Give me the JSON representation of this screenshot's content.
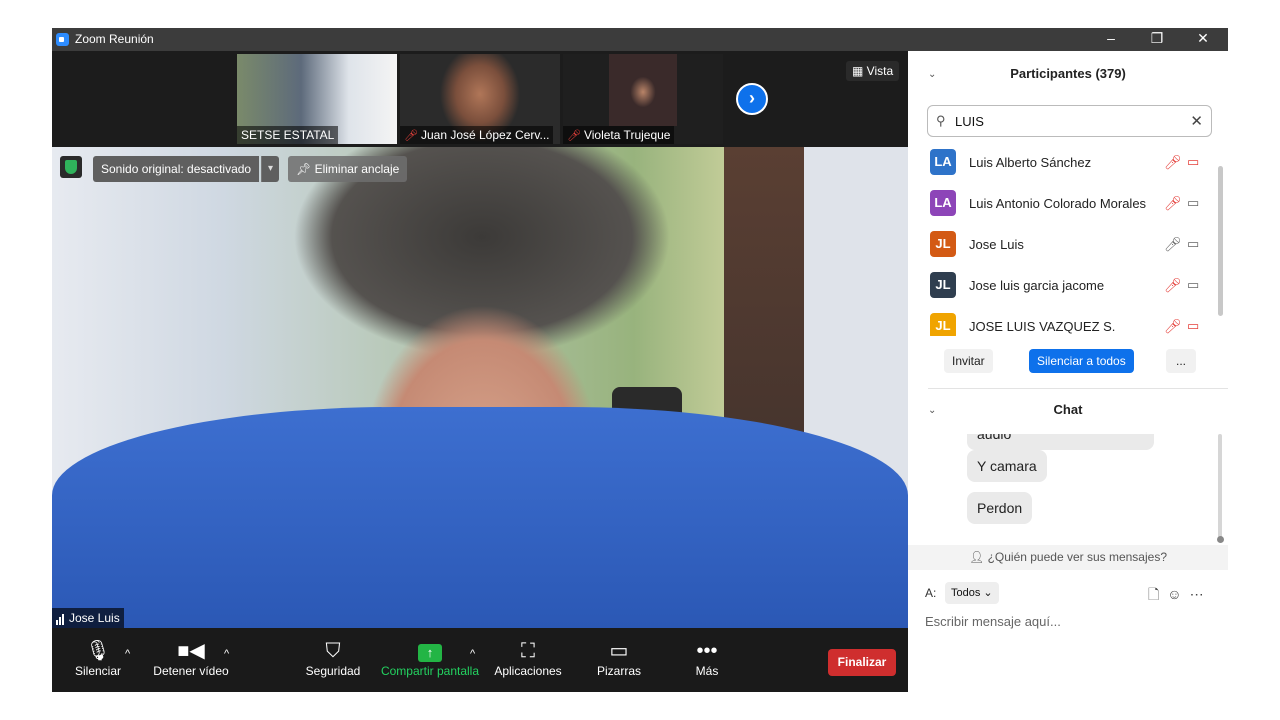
{
  "window": {
    "title": "Zoom Reunión",
    "minimize": "–",
    "restore": "❐",
    "close": "✕"
  },
  "strip": {
    "thumbs": [
      {
        "name": "SETSE ESTATAL",
        "muted": false
      },
      {
        "name": "Juan José López Cerv...",
        "muted": true
      },
      {
        "name": "Violeta Trujeque",
        "muted": true
      }
    ],
    "next_icon": "›",
    "view_label": "Vista"
  },
  "main": {
    "sound_label": "Sonido original: desactivado",
    "sound_caret": "▾",
    "unpin_label": "Eliminar anclaje",
    "speaker_name": "Jose Luis"
  },
  "toolbar": {
    "mute_label": "Silenciar",
    "video_label": "Detener vídeo",
    "security_label": "Seguridad",
    "share_label": "Compartir pantalla",
    "apps_label": "Aplicaciones",
    "whiteboards_label": "Pizarras",
    "more_label": "Más",
    "end_label": "Finalizar",
    "caret": "^"
  },
  "participants": {
    "title": "Participantes (379)",
    "search_value": "LUIS",
    "list": [
      {
        "initials": "LA",
        "name": "Luis Alberto Sánchez",
        "color": "#2e73c9",
        "mic_muted": true,
        "cam_off": true
      },
      {
        "initials": "LA",
        "name": "Luis Antonio Colorado Morales",
        "color": "#8d45b8",
        "mic_muted": true,
        "cam_off": false
      },
      {
        "initials": "JL",
        "name": "Jose Luis",
        "color": "#d35a14",
        "mic_muted": false,
        "cam_off": false
      },
      {
        "initials": "JL",
        "name": "Jose luis garcia jacome",
        "color": "#2f3e4f",
        "mic_muted": true,
        "cam_off": false
      },
      {
        "initials": "JL",
        "name": "JOSE LUIS VAZQUEZ S.",
        "color": "#f0a400",
        "mic_muted": true,
        "cam_off": true
      }
    ],
    "invite_label": "Invitar",
    "mute_all_label": "Silenciar a todos",
    "more_label": "..."
  },
  "chat": {
    "title": "Chat",
    "messages": [
      "audio",
      "Y camara",
      "Perdon"
    ],
    "who_sees": "¿Quién puede ver sus mensajes?",
    "to_label": "A:",
    "to_value": "Todos",
    "input_placeholder": "Escribir mensaje aquí..."
  },
  "colors": {
    "accent": "#0e71eb",
    "end_red": "#cf2e2e",
    "share_green": "#23b545",
    "muted_red": "#e5403b"
  }
}
